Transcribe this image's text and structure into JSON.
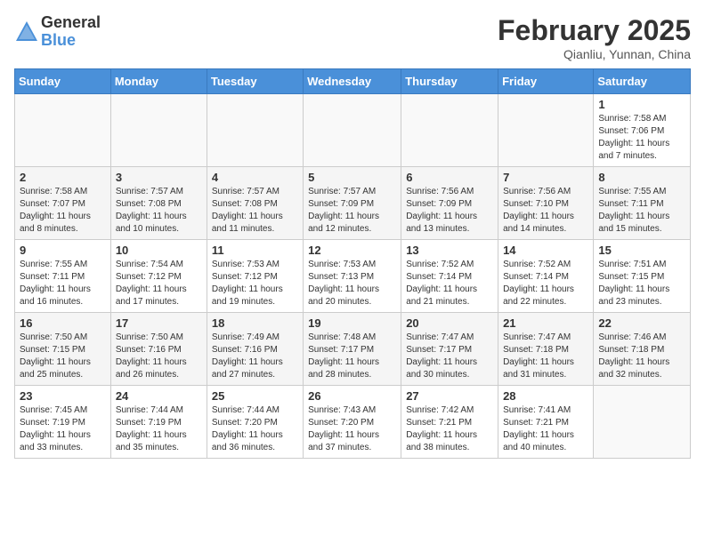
{
  "header": {
    "logo_general": "General",
    "logo_blue": "Blue",
    "title": "February 2025",
    "location": "Qianliu, Yunnan, China"
  },
  "calendar": {
    "days_of_week": [
      "Sunday",
      "Monday",
      "Tuesday",
      "Wednesday",
      "Thursday",
      "Friday",
      "Saturday"
    ],
    "weeks": [
      [
        {
          "day": "",
          "info": ""
        },
        {
          "day": "",
          "info": ""
        },
        {
          "day": "",
          "info": ""
        },
        {
          "day": "",
          "info": ""
        },
        {
          "day": "",
          "info": ""
        },
        {
          "day": "",
          "info": ""
        },
        {
          "day": "1",
          "info": "Sunrise: 7:58 AM\nSunset: 7:06 PM\nDaylight: 11 hours and 7 minutes."
        }
      ],
      [
        {
          "day": "2",
          "info": "Sunrise: 7:58 AM\nSunset: 7:07 PM\nDaylight: 11 hours and 8 minutes."
        },
        {
          "day": "3",
          "info": "Sunrise: 7:57 AM\nSunset: 7:08 PM\nDaylight: 11 hours and 10 minutes."
        },
        {
          "day": "4",
          "info": "Sunrise: 7:57 AM\nSunset: 7:08 PM\nDaylight: 11 hours and 11 minutes."
        },
        {
          "day": "5",
          "info": "Sunrise: 7:57 AM\nSunset: 7:09 PM\nDaylight: 11 hours and 12 minutes."
        },
        {
          "day": "6",
          "info": "Sunrise: 7:56 AM\nSunset: 7:09 PM\nDaylight: 11 hours and 13 minutes."
        },
        {
          "day": "7",
          "info": "Sunrise: 7:56 AM\nSunset: 7:10 PM\nDaylight: 11 hours and 14 minutes."
        },
        {
          "day": "8",
          "info": "Sunrise: 7:55 AM\nSunset: 7:11 PM\nDaylight: 11 hours and 15 minutes."
        }
      ],
      [
        {
          "day": "9",
          "info": "Sunrise: 7:55 AM\nSunset: 7:11 PM\nDaylight: 11 hours and 16 minutes."
        },
        {
          "day": "10",
          "info": "Sunrise: 7:54 AM\nSunset: 7:12 PM\nDaylight: 11 hours and 17 minutes."
        },
        {
          "day": "11",
          "info": "Sunrise: 7:53 AM\nSunset: 7:12 PM\nDaylight: 11 hours and 19 minutes."
        },
        {
          "day": "12",
          "info": "Sunrise: 7:53 AM\nSunset: 7:13 PM\nDaylight: 11 hours and 20 minutes."
        },
        {
          "day": "13",
          "info": "Sunrise: 7:52 AM\nSunset: 7:14 PM\nDaylight: 11 hours and 21 minutes."
        },
        {
          "day": "14",
          "info": "Sunrise: 7:52 AM\nSunset: 7:14 PM\nDaylight: 11 hours and 22 minutes."
        },
        {
          "day": "15",
          "info": "Sunrise: 7:51 AM\nSunset: 7:15 PM\nDaylight: 11 hours and 23 minutes."
        }
      ],
      [
        {
          "day": "16",
          "info": "Sunrise: 7:50 AM\nSunset: 7:15 PM\nDaylight: 11 hours and 25 minutes."
        },
        {
          "day": "17",
          "info": "Sunrise: 7:50 AM\nSunset: 7:16 PM\nDaylight: 11 hours and 26 minutes."
        },
        {
          "day": "18",
          "info": "Sunrise: 7:49 AM\nSunset: 7:16 PM\nDaylight: 11 hours and 27 minutes."
        },
        {
          "day": "19",
          "info": "Sunrise: 7:48 AM\nSunset: 7:17 PM\nDaylight: 11 hours and 28 minutes."
        },
        {
          "day": "20",
          "info": "Sunrise: 7:47 AM\nSunset: 7:17 PM\nDaylight: 11 hours and 30 minutes."
        },
        {
          "day": "21",
          "info": "Sunrise: 7:47 AM\nSunset: 7:18 PM\nDaylight: 11 hours and 31 minutes."
        },
        {
          "day": "22",
          "info": "Sunrise: 7:46 AM\nSunset: 7:18 PM\nDaylight: 11 hours and 32 minutes."
        }
      ],
      [
        {
          "day": "23",
          "info": "Sunrise: 7:45 AM\nSunset: 7:19 PM\nDaylight: 11 hours and 33 minutes."
        },
        {
          "day": "24",
          "info": "Sunrise: 7:44 AM\nSunset: 7:19 PM\nDaylight: 11 hours and 35 minutes."
        },
        {
          "day": "25",
          "info": "Sunrise: 7:44 AM\nSunset: 7:20 PM\nDaylight: 11 hours and 36 minutes."
        },
        {
          "day": "26",
          "info": "Sunrise: 7:43 AM\nSunset: 7:20 PM\nDaylight: 11 hours and 37 minutes."
        },
        {
          "day": "27",
          "info": "Sunrise: 7:42 AM\nSunset: 7:21 PM\nDaylight: 11 hours and 38 minutes."
        },
        {
          "day": "28",
          "info": "Sunrise: 7:41 AM\nSunset: 7:21 PM\nDaylight: 11 hours and 40 minutes."
        },
        {
          "day": "",
          "info": ""
        }
      ]
    ]
  }
}
